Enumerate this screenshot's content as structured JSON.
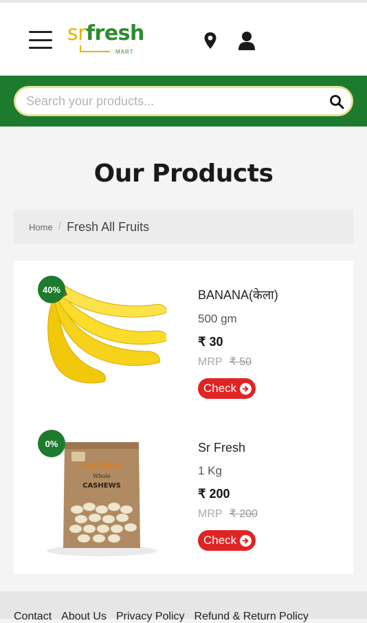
{
  "header": {
    "logo": {
      "sr": "sr",
      "fresh": "fresh",
      "mart": "MART"
    }
  },
  "search": {
    "placeholder": "Search your products..."
  },
  "page_title": "Our Products",
  "breadcrumb": {
    "home": "Home",
    "separator": "/",
    "current": "Fresh All Fruits"
  },
  "products": [
    {
      "badge": "40%",
      "name": "BANANA(केला)",
      "qty": "500 gm",
      "price": "₹ 30",
      "mrp_label": "MRP",
      "mrp": "₹ 50",
      "button": "Check"
    },
    {
      "badge": "0%",
      "name": "Sr Fresh",
      "qty": "1 Kg",
      "price": "₹ 200",
      "mrp_label": "MRP",
      "mrp": "₹ 200",
      "button": "Check"
    }
  ],
  "footer": {
    "links": [
      "Contact",
      "About Us",
      "Privacy Policy",
      "Refund & Return Policy"
    ]
  },
  "colors": {
    "brand_green": "#1e7b2e",
    "accent_yellow": "#e5b400",
    "check_red": "#e02323"
  }
}
